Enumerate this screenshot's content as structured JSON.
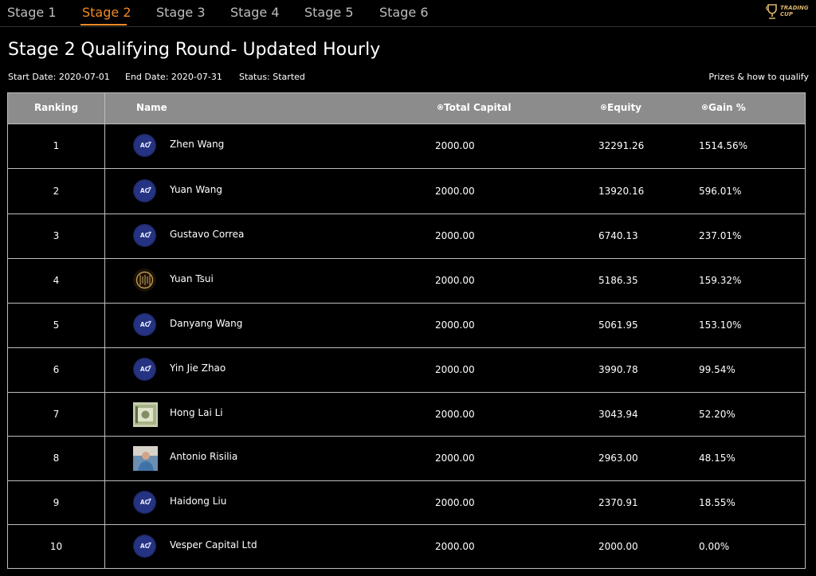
{
  "tabs": [
    {
      "label": "Stage 1",
      "active": false
    },
    {
      "label": "Stage 2",
      "active": true
    },
    {
      "label": "Stage 3",
      "active": false
    },
    {
      "label": "Stage 4",
      "active": false
    },
    {
      "label": "Stage 5",
      "active": false
    },
    {
      "label": "Stage 6",
      "active": false
    }
  ],
  "logo": {
    "line1": "TRADING",
    "line2": "CUP",
    "icon": "trophy-icon"
  },
  "page": {
    "title": "Stage 2 Qualifying Round- Updated Hourly",
    "start_date": "Start Date: 2020-07-01",
    "end_date": "End Date: 2020-07-31",
    "status": "Status: Started",
    "prizes_link": "Prizes & how to qualify"
  },
  "table": {
    "headers": {
      "ranking": "Ranking",
      "name": "Name",
      "total_capital": "Total Capital",
      "equity": "Equity",
      "gain": "Gain %"
    },
    "rows": [
      {
        "rank": "1",
        "name": "Zhen Wang",
        "avatar": "acy-logo",
        "capital": "2000.00",
        "equity": "32291.26",
        "gain": "1514.56%"
      },
      {
        "rank": "2",
        "name": "Yuan Wang",
        "avatar": "acy-logo",
        "capital": "2000.00",
        "equity": "13920.16",
        "gain": "596.01%"
      },
      {
        "rank": "3",
        "name": "Gustavo Correa",
        "avatar": "acy-logo",
        "capital": "2000.00",
        "equity": "6740.13",
        "gain": "237.01%"
      },
      {
        "rank": "4",
        "name": "Yuan Tsui",
        "avatar": "gold-emblem",
        "capital": "2000.00",
        "equity": "5186.35",
        "gain": "159.32%"
      },
      {
        "rank": "5",
        "name": "Danyang Wang",
        "avatar": "acy-logo",
        "capital": "2000.00",
        "equity": "5061.95",
        "gain": "153.10%"
      },
      {
        "rank": "6",
        "name": "Yin Jie Zhao",
        "avatar": "acy-logo",
        "capital": "2000.00",
        "equity": "3990.78",
        "gain": "99.54%"
      },
      {
        "rank": "7",
        "name": "Hong Lai Li",
        "avatar": "banknote-photo",
        "capital": "2000.00",
        "equity": "3043.94",
        "gain": "52.20%"
      },
      {
        "rank": "8",
        "name": "Antonio Risilia",
        "avatar": "person-photo",
        "capital": "2000.00",
        "equity": "2963.00",
        "gain": "48.15%"
      },
      {
        "rank": "9",
        "name": "Haidong Liu",
        "avatar": "acy-logo",
        "capital": "2000.00",
        "equity": "2370.91",
        "gain": "18.55%"
      },
      {
        "rank": "10",
        "name": "Vesper Capital Ltd",
        "avatar": "acy-logo",
        "capital": "2000.00",
        "equity": "2000.00",
        "gain": "0.00%"
      }
    ]
  }
}
